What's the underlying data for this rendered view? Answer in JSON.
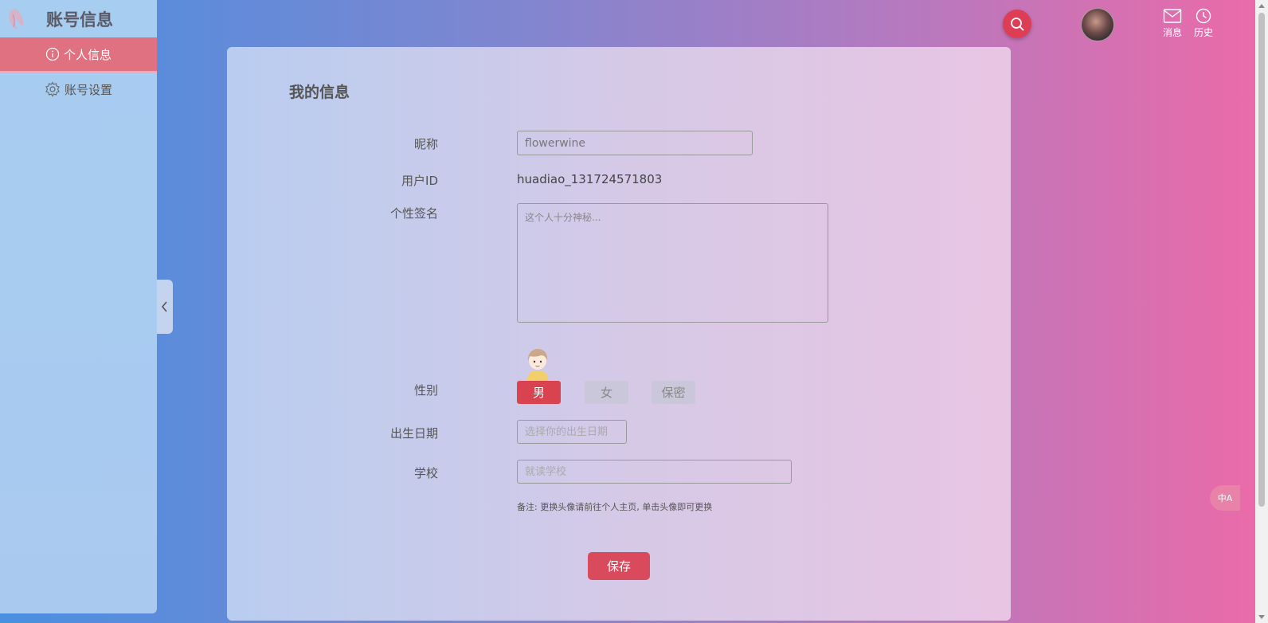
{
  "sidebar": {
    "title": "账号信息",
    "items": [
      {
        "label": "个人信息",
        "active": true
      },
      {
        "label": "账号设置",
        "active": false
      }
    ]
  },
  "header": {
    "messages_label": "消息",
    "history_label": "历史"
  },
  "profile": {
    "title": "我的信息",
    "nickname_label": "昵称",
    "nickname_value": "flowerwine",
    "userid_label": "用户ID",
    "userid_value": "huadiao_131724571803",
    "signature_label": "个性签名",
    "signature_placeholder": "这个人十分神秘...",
    "gender_label": "性别",
    "gender_options": [
      "男",
      "女",
      "保密"
    ],
    "gender_selected": "男",
    "birth_label": "出生日期",
    "birth_placeholder": "选择你的出生日期",
    "school_label": "学校",
    "school_placeholder": "就读学校",
    "note": "备注: 更换头像请前往个人主页, 单击头像即可更换",
    "save_label": "保存"
  },
  "colors": {
    "accent": "#d9424f",
    "sidebar_active": "#e07180",
    "search_button": "#de3e55"
  },
  "translate_icon_label": "中A"
}
